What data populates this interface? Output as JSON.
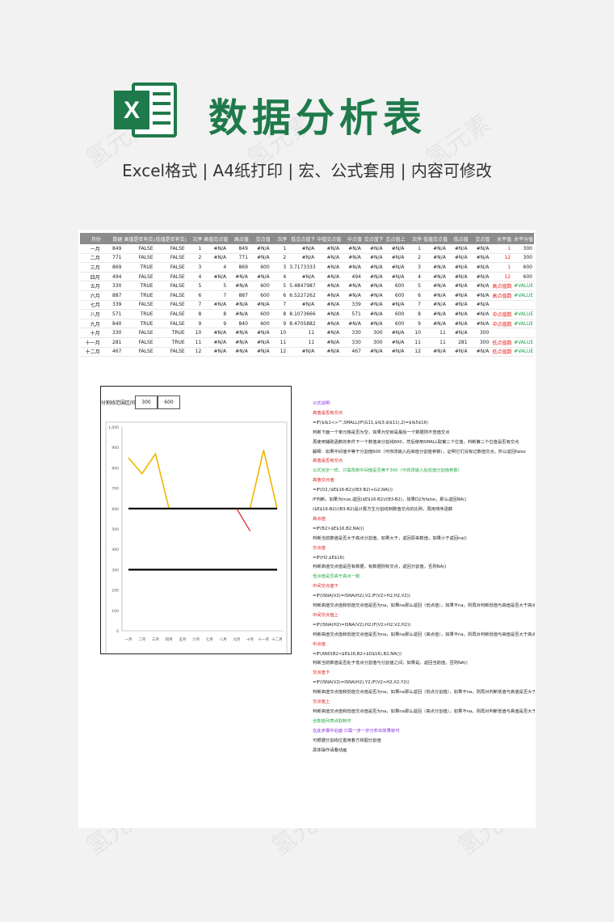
{
  "hero": {
    "title": "数据分析表",
    "subtitle": "Excel格式 |  A4纸打印 | 宏、公式套用 | 内容可修改",
    "logo_letter": "X"
  },
  "colors": {
    "brand_green": "#1f7a4b",
    "header_gray": "#8c8c8c",
    "line_orange": "#f4b400",
    "red": "#e02020",
    "green": "#1fa04a"
  },
  "table": {
    "headers": [
      "月份",
      "数据",
      "高值是否有交点",
      "低值是否有交点",
      "次序",
      "高值交点值",
      "高点值",
      "交点值",
      "次序",
      "低交点值下",
      "中值交点值上",
      "中点值",
      "交点值下",
      "交点值上",
      "次序",
      "低值交点值",
      "低点值",
      "交点值",
      "水平值",
      "水平分值"
    ],
    "rows": [
      [
        "一月",
        "849",
        "FALSE",
        "FALSE",
        "1",
        "#N/A",
        "849",
        "#N/A",
        "1",
        "#N/A",
        "#N/A",
        "#N/A",
        "#N/A",
        "#N/A",
        "1",
        "#N/A",
        "#N/A",
        "#N/A",
        "1",
        "300"
      ],
      [
        "二月",
        "771",
        "FALSE",
        "FALSE",
        "2",
        "#N/A",
        "771",
        "#N/A",
        "2",
        "#N/A",
        "#N/A",
        "#N/A",
        "#N/A",
        "#N/A",
        "2",
        "#N/A",
        "#N/A",
        "#N/A",
        "12",
        "300"
      ],
      [
        "三月",
        "869",
        "TRUE",
        "FALSE",
        "3",
        "4",
        "869",
        "600",
        "3",
        "3.71733333",
        "#N/A",
        "#N/A",
        "#N/A",
        "#N/A",
        "3",
        "#N/A",
        "#N/A",
        "#N/A",
        "1",
        "600"
      ],
      [
        "四月",
        "494",
        "FALSE",
        "FALSE",
        "4",
        "#N/A",
        "#N/A",
        "#N/A",
        "4",
        "#N/A",
        "#N/A",
        "494",
        "#N/A",
        "#N/A",
        "4",
        "#N/A",
        "#N/A",
        "#N/A",
        "12",
        "600"
      ],
      [
        "五月",
        "330",
        "TRUE",
        "FALSE",
        "5",
        "5",
        "#N/A",
        "600",
        "5",
        "5.48479877",
        "#N/A",
        "#N/A",
        "#N/A",
        "600",
        "5",
        "#N/A",
        "#N/A",
        "#N/A",
        "高点值数据",
        "#VALUE!"
      ],
      [
        "六月",
        "887",
        "TRUE",
        "FALSE",
        "6",
        "7",
        "887",
        "600",
        "6",
        "6.52272628",
        "#N/A",
        "#N/A",
        "#N/A",
        "600",
        "6",
        "#N/A",
        "#N/A",
        "#N/A",
        "高点值数据",
        "#VALUE!"
      ],
      [
        "七月",
        "339",
        "FALSE",
        "FALSE",
        "7",
        "#N/A",
        "#N/A",
        "#N/A",
        "7",
        "#N/A",
        "#N/A",
        "339",
        "#N/A",
        "#N/A",
        "7",
        "#N/A",
        "#N/A",
        "#N/A",
        "",
        ""
      ],
      [
        "八月",
        "571",
        "TRUE",
        "FALSE",
        "8",
        "8",
        "#N/A",
        "600",
        "8",
        "8.10736669",
        "#N/A",
        "571",
        "#N/A",
        "600",
        "8",
        "#N/A",
        "#N/A",
        "#N/A",
        "中点值数据",
        "#VALUE!"
      ],
      [
        "九月",
        "840",
        "TRUE",
        "FALSE",
        "9",
        "9",
        "840",
        "600",
        "9",
        "8.47058825",
        "#N/A",
        "#N/A",
        "#N/A",
        "600",
        "9",
        "#N/A",
        "#N/A",
        "#N/A",
        "中点值数据",
        "#VALUE!"
      ],
      [
        "十月",
        "330",
        "FALSE",
        "TRUE",
        "10",
        "#N/A",
        "#N/A",
        "#N/A",
        "10",
        "11",
        "#N/A",
        "330",
        "300",
        "#N/A",
        "10",
        "11",
        "#N/A",
        "300",
        "",
        ""
      ],
      [
        "十一月",
        "281",
        "FALSE",
        "TRUE",
        "11",
        "#N/A",
        "#N/A",
        "#N/A",
        "11",
        "11",
        "#N/A",
        "330",
        "300",
        "#N/A",
        "11",
        "11",
        "281",
        "300",
        "低点值数据",
        "#VALUE!"
      ],
      [
        "十二月",
        "467",
        "FALSE",
        "FALSE",
        "12",
        "#N/A",
        "#N/A",
        "#N/A",
        "12",
        "#N/A",
        "#N/A",
        "467",
        "#N/A",
        "#N/A",
        "12",
        "#N/A",
        "#N/A",
        "#N/A",
        "低点值数据",
        "#VALUE!"
      ]
    ]
  },
  "chart": {
    "range_label": "分割线范围区间",
    "range_low": "300",
    "range_high": "600"
  },
  "chart_data": {
    "type": "line",
    "categories": [
      "一月",
      "二月",
      "三月",
      "四月",
      "五月",
      "六月",
      "七月",
      "八月",
      "九月",
      "十月",
      "十一月",
      "十二月"
    ],
    "ylim": [
      0,
      1000
    ],
    "yticks": [
      "0",
      "100",
      "200",
      "300",
      "400",
      "500",
      "600",
      "700",
      "800",
      "900",
      "1,000"
    ],
    "series": [
      {
        "values": [
          849,
          771,
          869,
          600,
          600,
          600,
          600,
          600,
          600,
          600,
          887,
          600
        ],
        "color": "#f4b400"
      },
      {
        "values": [
          600,
          600,
          600,
          600,
          600,
          600,
          600,
          600,
          600,
          600,
          600,
          600
        ],
        "color": "#000000"
      },
      {
        "values": [
          300,
          300,
          300,
          300,
          300,
          300,
          300,
          300,
          300,
          300,
          300,
          300
        ],
        "color": "#000000"
      }
    ],
    "red_segment": {
      "from": [
        9,
        600
      ],
      "to": [
        9.5,
        490
      ]
    }
  },
  "notes": [
    {
      "t": "公式说明",
      "c": "c-purple"
    },
    {
      "t": "高值是否有交点",
      "c": "c-red"
    },
    {
      "t": "=IF($I$1<>\"\",SMALL(IF(G11,$I$3:$I$11),2)=$I$5$16)",
      "c": "c-black"
    },
    {
      "t": "判断下面一个单元格是否为空，如果为空就是最后一个数据则不查值交点",
      "c": "c-black"
    },
    {
      "t": "再使用辅助函数的条件下一个数值来分割线600，然后使用SMALL取第二个位值，判断第二个位值是否有交点",
      "c": "c-black"
    },
    {
      "t": "解释：如果中间值不等于分割值600（可修改输入后高值分割值参数），证明它们没有过数值交点，所以返回false",
      "c": "c-black"
    },
    {
      "t": "高值是否有交点",
      "c": "c-red"
    },
    {
      "t": "公式完全一样，只需改新中间值是否等于300（可修改输入后低值分割值参数）",
      "c": "c-green"
    },
    {
      "t": "高值交点值",
      "c": "c-red"
    },
    {
      "t": "=IF(D2,($E$16-B2)/(B3-B2)+G2,NA())",
      "c": "c-black"
    },
    {
      "t": "IF判断，如果为true,返回($E$16-B2)/(B3-B2)，如果D2为false，那么返回NA()",
      "c": "c-black"
    },
    {
      "t": "($E$16-B2)/(B3-B2)是计算方生分割线到数值交点的比例，再用排序函数",
      "c": "c-black"
    },
    {
      "t": "高点值",
      "c": "c-red"
    },
    {
      "t": "=IF(B2>$E$16,B2,NA())",
      "c": "c-black"
    },
    {
      "t": "判断当前数值是否大于高点分割值，如果大于，返回原来数值，如果小于返回na()",
      "c": "c-black"
    },
    {
      "t": "交点值",
      "c": "c-red"
    },
    {
      "t": "=IF(H2,$E$16)",
      "c": "c-black"
    },
    {
      "t": "判断高值交点值是否有数据，有数据则有交点，返回分割值，否则NA()",
      "c": "c-black"
    },
    {
      "t": "低点值是否高于高点一致",
      "c": "c-green"
    },
    {
      "t": "中间交点值下",
      "c": "c-red"
    },
    {
      "t": "=IF(ISNA(V2)=ISNA(H2),V2,IF(V2>H2,H2,V2))",
      "c": "c-black"
    },
    {
      "t": "判断高值交点值和低值交点值是否为na，如果na那么返回（低点值），如果不na，则再对判断低值与高值是否大于高点值，如果大于返回低点值",
      "c": "c-black"
    },
    {
      "t": "中间交点值上",
      "c": "c-red"
    },
    {
      "t": "=IF(ISNA(H2)=ISNA(V2),H2,IF(V2>H2,V2,H2))",
      "c": "c-black"
    },
    {
      "t": "判断高值交点值和低值交点值是否为na，如果na那么返回（高点值），如果不na，则再对判断低值与高值是否大于高点值，如果大于返回低点值",
      "c": "c-black"
    },
    {
      "t": "中点值",
      "c": "c-red"
    },
    {
      "t": "=IF(AND(B2<$E$16,B2>$D$16),B2,NA())",
      "c": "c-black"
    },
    {
      "t": "判断当前数值是否处于低点分割值与分割值之间，如果是，返回当前值，否则NA()",
      "c": "c-black"
    },
    {
      "t": "交点值下",
      "c": "c-red"
    },
    {
      "t": "=IF(ISNA(V2)=ISNA(H2),Y2,IF(V2>H2,X2,Y2))",
      "c": "c-black"
    },
    {
      "t": "判断高值交点值和低值交点值是否为na，如果na那么返回（低点分割值），如果不na，则再对判断低值与高值是否大于高点值，如果大于返回高点分割值",
      "c": "c-black"
    },
    {
      "t": "交点值上",
      "c": "c-red"
    },
    {
      "t": "判断高值交点值和低值交点值是否为na，如果na那么返回（高点分割值），如果不na，则再对判断低值与高值是否大于高点值，如果大于返回低点分割值",
      "c": "c-black"
    },
    {
      "t": "全数值列表点取制作",
      "c": "c-green"
    },
    {
      "t": "在此步骤中后面 只需一步一步分析出效果就可",
      "c": "c-purple"
    },
    {
      "t": "可根据分割线位置用着方将图分割值",
      "c": "c-black"
    },
    {
      "t": "具体操作请看动画",
      "c": "c-black"
    }
  ],
  "watermark": "氢元素"
}
